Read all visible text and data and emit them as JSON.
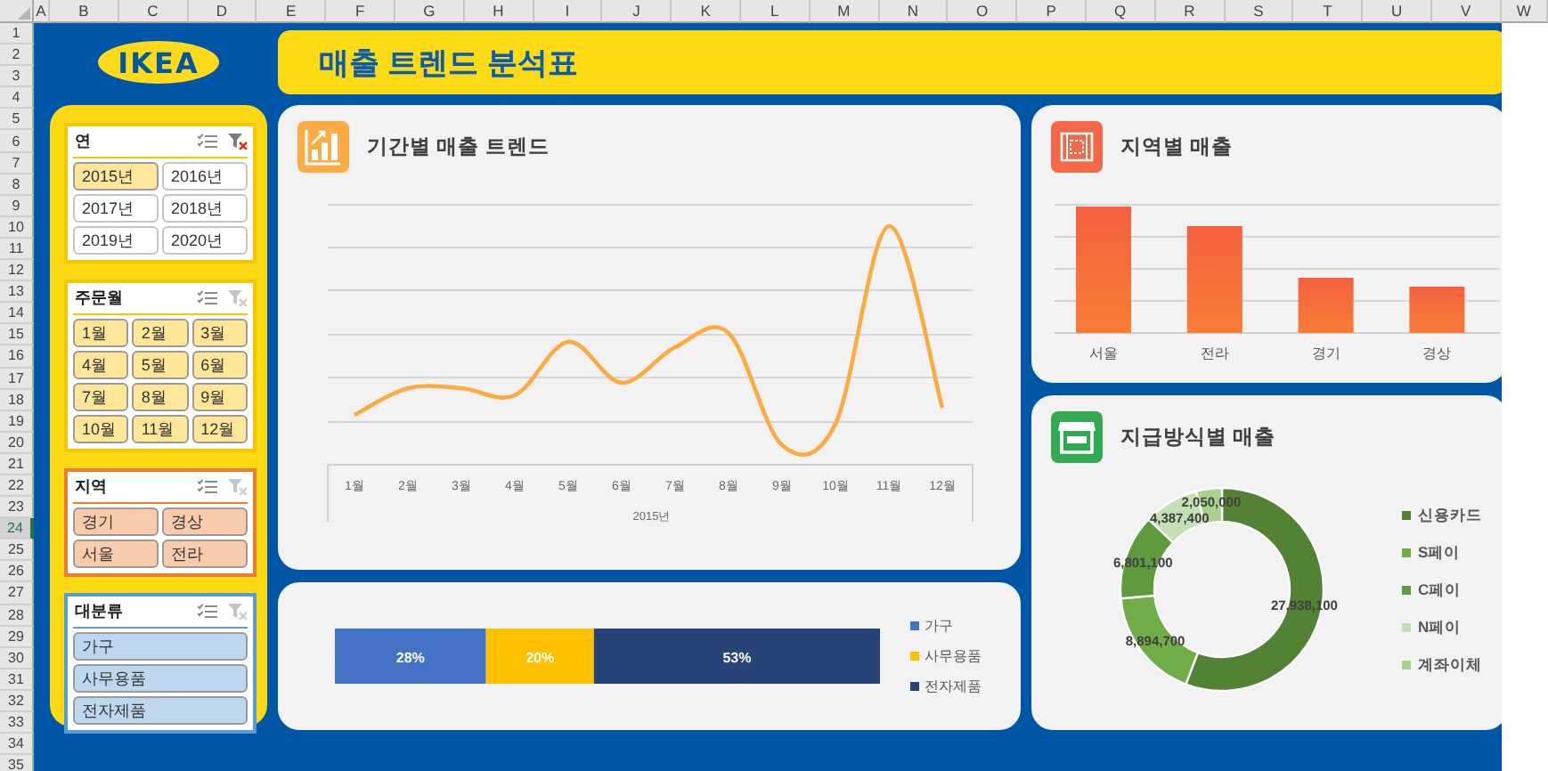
{
  "sheet": {
    "columns": [
      "A",
      "B",
      "C",
      "D",
      "E",
      "F",
      "G",
      "H",
      "I",
      "J",
      "K",
      "L",
      "M",
      "N",
      "O",
      "P",
      "Q",
      "R",
      "S",
      "T",
      "U",
      "V",
      "W"
    ],
    "rows": [
      {
        "label": "1",
        "selected": false
      },
      {
        "label": "2",
        "selected": false
      },
      {
        "label": "3",
        "selected": false
      },
      {
        "label": "4",
        "selected": false
      },
      {
        "label": "5",
        "selected": false
      },
      {
        "label": "6",
        "selected": false
      },
      {
        "label": "7",
        "selected": false
      },
      {
        "label": "8",
        "selected": false
      },
      {
        "label": "9",
        "selected": false
      },
      {
        "label": "10",
        "selected": false
      },
      {
        "label": "11",
        "selected": false
      },
      {
        "label": "12",
        "selected": false
      },
      {
        "label": "13",
        "selected": false
      },
      {
        "label": "14",
        "selected": false
      },
      {
        "label": "15",
        "selected": false
      },
      {
        "label": "16",
        "selected": false
      },
      {
        "label": "17",
        "selected": false
      },
      {
        "label": "18",
        "selected": false
      },
      {
        "label": "19",
        "selected": false
      },
      {
        "label": "20",
        "selected": false
      },
      {
        "label": "21",
        "selected": false
      },
      {
        "label": "22",
        "selected": false
      },
      {
        "label": "23",
        "selected": false
      },
      {
        "label": "24",
        "selected": true
      },
      {
        "label": "25",
        "selected": false
      },
      {
        "label": "26",
        "selected": false
      },
      {
        "label": "27",
        "selected": false
      },
      {
        "label": "28",
        "selected": false
      },
      {
        "label": "29",
        "selected": false
      },
      {
        "label": "30",
        "selected": false
      },
      {
        "label": "31",
        "selected": false
      },
      {
        "label": "32",
        "selected": false
      },
      {
        "label": "33",
        "selected": false
      },
      {
        "label": "34",
        "selected": false
      },
      {
        "label": "35",
        "selected": false
      }
    ]
  },
  "logo": {
    "text": "IKEA"
  },
  "title": "매출 트렌드 분석표",
  "slicers": [
    {
      "title": "연",
      "items": [
        {
          "label": "2015년",
          "selected": true
        },
        {
          "label": "2016년",
          "selected": false
        },
        {
          "label": "2017년",
          "selected": false
        },
        {
          "label": "2018년",
          "selected": false
        },
        {
          "label": "2019년",
          "selected": false
        },
        {
          "label": "2020년",
          "selected": false
        }
      ]
    },
    {
      "title": "주문월",
      "items": [
        {
          "label": "1월",
          "selected": true
        },
        {
          "label": "2월",
          "selected": true
        },
        {
          "label": "3월",
          "selected": true
        },
        {
          "label": "4월",
          "selected": true
        },
        {
          "label": "5월",
          "selected": true
        },
        {
          "label": "6월",
          "selected": true
        },
        {
          "label": "7월",
          "selected": true
        },
        {
          "label": "8월",
          "selected": true
        },
        {
          "label": "9월",
          "selected": true
        },
        {
          "label": "10월",
          "selected": true
        },
        {
          "label": "11월",
          "selected": true
        },
        {
          "label": "12월",
          "selected": true
        }
      ]
    },
    {
      "title": "지역",
      "items": [
        {
          "label": "경기",
          "selected": true
        },
        {
          "label": "경상",
          "selected": true
        },
        {
          "label": "서울",
          "selected": true
        },
        {
          "label": "전라",
          "selected": true
        }
      ]
    },
    {
      "title": "대분류",
      "items": [
        {
          "label": "가구",
          "selected": true
        },
        {
          "label": "사무용품",
          "selected": true
        },
        {
          "label": "전자제품",
          "selected": true
        }
      ]
    }
  ],
  "trend_chart": {
    "title": "기간별 매출 트렌드",
    "x_labels": [
      "1월",
      "2월",
      "3월",
      "4월",
      "5월",
      "6월",
      "7월",
      "8월",
      "9월",
      "10월",
      "11월",
      "12월"
    ],
    "axis_title": "2015년"
  },
  "category_share": {
    "chart_data": {
      "type": "bar",
      "orientation": "horizontal",
      "stacked": true,
      "series": [
        {
          "name": "가구",
          "color": "#4472c4",
          "values": [
            28
          ],
          "value_labels": [
            "28%"
          ]
        },
        {
          "name": "사무용품",
          "color": "#ffc000",
          "values": [
            20
          ],
          "value_labels": [
            "20%"
          ]
        },
        {
          "name": "전자제품",
          "color": "#264478",
          "values": [
            53
          ],
          "value_labels": [
            "53%"
          ]
        }
      ]
    }
  },
  "region_chart": {
    "title": "지역별 매출",
    "x_labels": [
      "서울",
      "전라",
      "경기",
      "경상"
    ]
  },
  "payment_chart": {
    "title": "지급방식별 매출",
    "chart_data": {
      "type": "donut",
      "data_labels": true,
      "categories": [
        "신용카드",
        "S페이",
        "C페이",
        "N페이",
        "계좌이체"
      ],
      "values": [
        27938100,
        8894700,
        6801100,
        4387400,
        2050000
      ],
      "value_labels": [
        "27,938,100",
        "8,894,700",
        "6,801,100",
        "4,387,400",
        "2,050,000"
      ]
    },
    "legend": [
      {
        "color": "#548235"
      },
      {
        "color": "#70ad47"
      },
      {
        "color": "#5f9a3e"
      },
      {
        "color": "#c5e0b4"
      },
      {
        "color": "#a9d18e"
      }
    ]
  }
}
